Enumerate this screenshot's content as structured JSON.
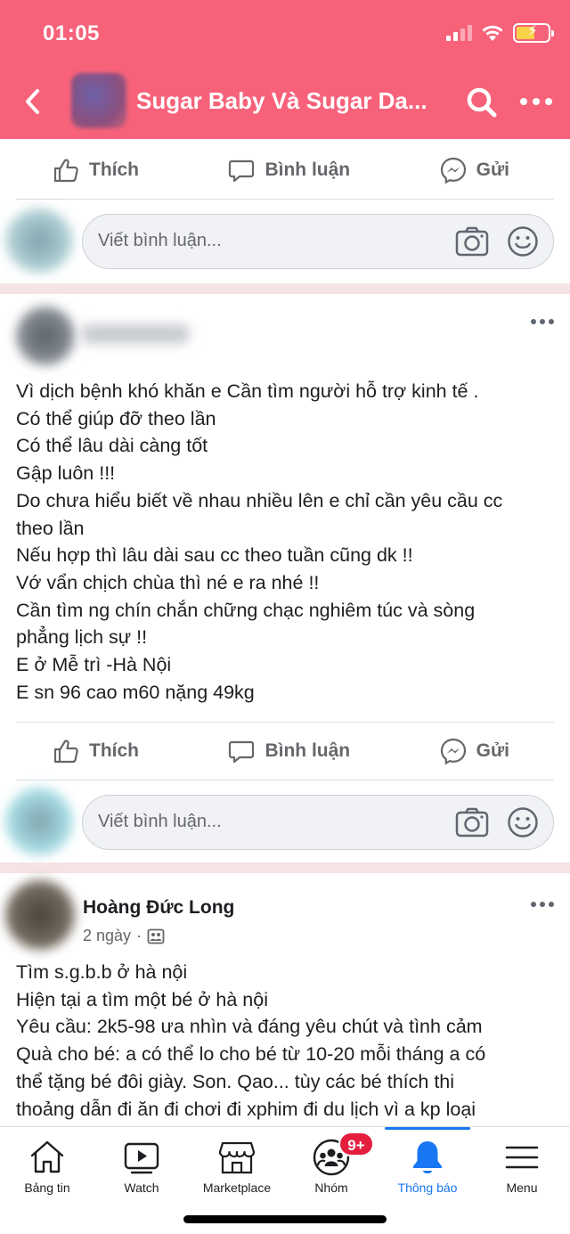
{
  "status_bar": {
    "time": "01:05"
  },
  "header": {
    "title": "Sugar Baby Và Sugar Da...",
    "accent": "#f7627a"
  },
  "actions": {
    "like": "Thích",
    "comment": "Bình luận",
    "send": "Gửi"
  },
  "comment_placeholder": "Viết bình luận...",
  "post1": {
    "lines": [
      "Vì dịch bệnh khó  khăn e Cần tìm người hỗ trợ kinh tế .",
      "Có thể giúp đỡ theo lần",
      "Có thể lâu dài càng tốt",
      "Gập luôn !!!",
      "Do chưa hiểu biết về nhau nhiều lên e chỉ cần yêu cầu cc",
      "theo lần",
      "Nếu hợp thì lâu dài sau cc theo tuần cũng dk !!",
      "Vớ vẩn chịch chùa thì né e ra nhé !!",
      "Cần tìm ng chín chắn chững chạc nghiêm túc và sòng",
      "phẳng lịch sự !!",
      "E ở Mễ trì -Hà Nội",
      "E sn 96 cao m60 nặng 49kg"
    ]
  },
  "post2": {
    "author": "Hoàng Đức Long",
    "time": "2 ngày",
    "lines": [
      "Tìm s.g.b.b ở hà nội",
      "Hiện tại a tìm một bé ở hà nội",
      "Yêu cầu: 2k5-98 ưa nhìn và đáng yêu chút và tình cảm",
      "Quà cho bé: a có thể lo cho bé từ 10-20 mỗi tháng a có",
      "thể tặng bé đôi giày. Son. Qao... tùy các bé thích thi",
      "thoảng dẫn đi ăn đi chơi đi xphim đi du lịch vì a kp loại"
    ]
  },
  "tabs": [
    {
      "label": "Bảng tin",
      "icon": "home-icon"
    },
    {
      "label": "Watch",
      "icon": "watch-icon"
    },
    {
      "label": "Marketplace",
      "icon": "marketplace-icon"
    },
    {
      "label": "Nhóm",
      "icon": "groups-icon"
    },
    {
      "label": "Thông báo",
      "icon": "bell-icon",
      "active": true
    },
    {
      "label": "Menu",
      "icon": "menu-icon"
    }
  ],
  "groups_badge": "9+",
  "active_color": "#1877f2"
}
